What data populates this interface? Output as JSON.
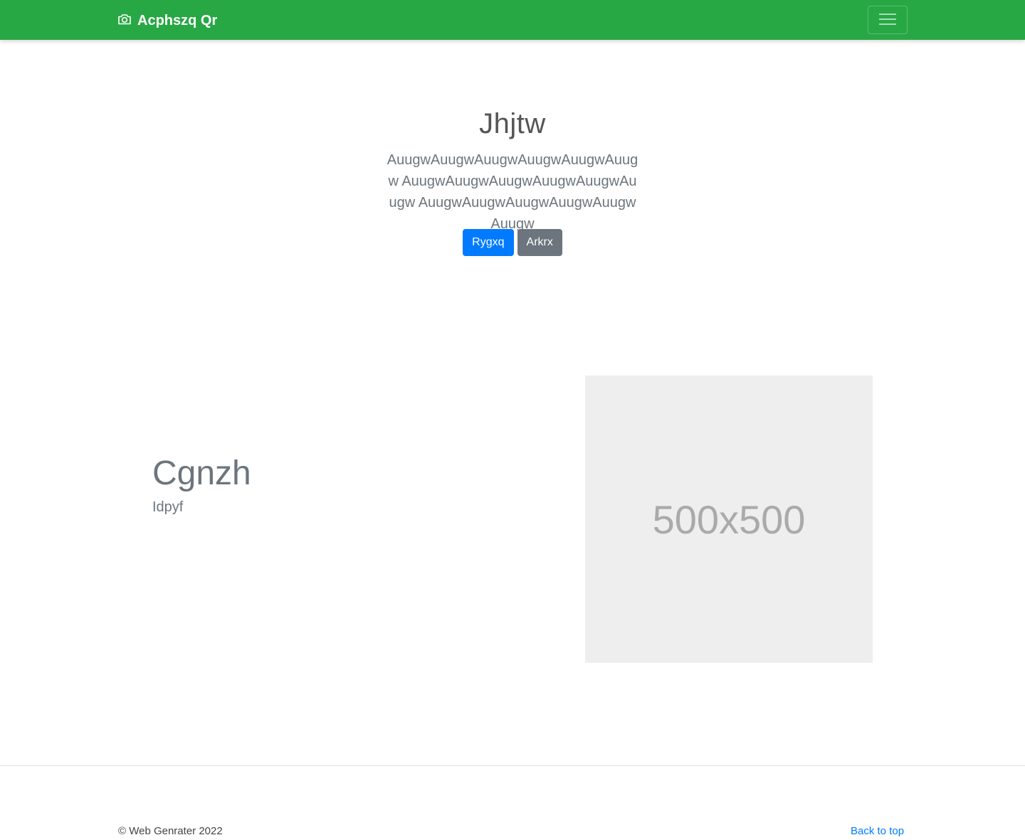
{
  "navbar": {
    "brand_label": "Acphszq Qr",
    "brand_icon": "camera-icon",
    "toggler_icon": "hamburger-icon",
    "background": "#28a745"
  },
  "hero": {
    "title": "Jhjtw",
    "lead": "AuugwAuugwAuugwAuugwAuugwAuugw AuugwAuugwAuugwAuugwAuugwAuugw AuugwAuugwAuugwAuugwAuugwAuugw",
    "primary_button": "Rygxq",
    "secondary_button": "Arkrx"
  },
  "feature": {
    "heading": "Cgnzh",
    "subheading": "Idpyf",
    "image_label": "500x500"
  },
  "footer": {
    "copyright": "© Web Genrater 2022",
    "back_to_top": "Back to top"
  },
  "colors": {
    "primary": "#007bff",
    "secondary": "#6c757d",
    "success": "#28a745"
  }
}
